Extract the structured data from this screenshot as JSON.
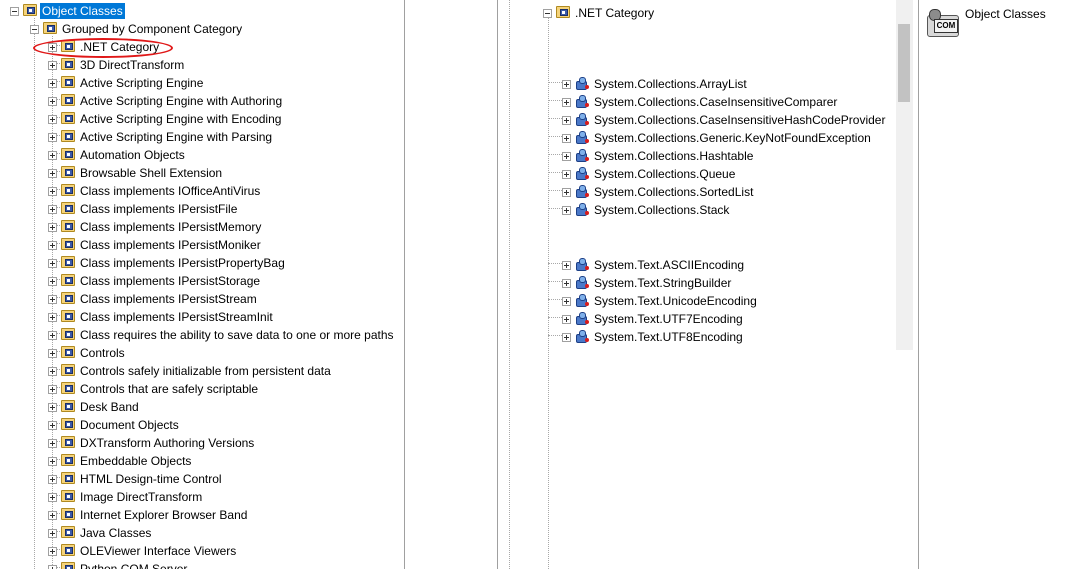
{
  "left_tree": {
    "root": {
      "label": "Object Classes",
      "icon": "folder-icon",
      "expanded": true,
      "selected": true
    },
    "group": {
      "label": "Grouped by Component Category",
      "icon": "folder-icon",
      "expanded": true
    },
    "categories": [
      ".NET Category",
      "3D DirectTransform",
      "Active Scripting Engine",
      "Active Scripting Engine with Authoring",
      "Active Scripting Engine with Encoding",
      "Active Scripting Engine with Parsing",
      "Automation Objects",
      "Browsable Shell Extension",
      "Class implements IOfficeAntiVirus",
      "Class implements IPersistFile",
      "Class implements IPersistMemory",
      "Class implements IPersistMoniker",
      "Class implements IPersistPropertyBag",
      "Class implements IPersistStorage",
      "Class implements IPersistStream",
      "Class implements IPersistStreamInit",
      "Class requires the ability to save data to one or more paths",
      "Controls",
      "Controls safely initializable from persistent data",
      "Controls that are safely scriptable",
      "Desk Band",
      "Document Objects",
      "DXTransform Authoring Versions",
      "Embeddable Objects",
      "HTML Design-time Control",
      "Image DirectTransform",
      "Internet Explorer Browser Band",
      "Java Classes",
      "OLEViewer Interface Viewers",
      "Python COM Server"
    ],
    "highlight_color": "#e01818",
    "selection_color": "#0078d7"
  },
  "mid_tree": {
    "root": {
      "label": ".NET Category",
      "icon": "folder-icon",
      "expanded": true
    },
    "collections_classes": [
      "System.Collections.ArrayList",
      "System.Collections.CaseInsensitiveComparer",
      "System.Collections.CaseInsensitiveHashCodeProvider",
      "System.Collections.Generic.KeyNotFoundException",
      "System.Collections.Hashtable",
      "System.Collections.Queue",
      "System.Collections.SortedList",
      "System.Collections.Stack"
    ],
    "text_classes": [
      "System.Text.ASCIIEncoding",
      "System.Text.StringBuilder",
      "System.Text.UnicodeEncoding",
      "System.Text.UTF7Encoding",
      "System.Text.UTF8Encoding"
    ]
  },
  "right_panel": {
    "icon": "com-icon",
    "icon_text": "COM",
    "label": "Object Classes"
  }
}
